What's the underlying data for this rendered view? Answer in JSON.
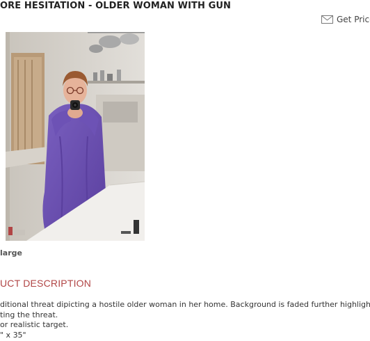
{
  "product": {
    "title": "ORE HESITATION - OLDER WOMAN WITH GUN",
    "image_alt": "Older woman in purple robe aiming a revolver in a kitchen",
    "enlarge_label": "large"
  },
  "header": {
    "get_price_label": "Get Price",
    "get_price_icon": "envelope-icon"
  },
  "description": {
    "heading": "UCT DESCRIPTION",
    "lines": [
      "ditional threat dipicting a hostile older woman in her home. Background is faded further highlighting",
      "ting the threat.",
      "or realistic target.",
      "\" x 35\""
    ]
  },
  "colors": {
    "heading_accent": "#b14545",
    "robe": "#6a4fb0",
    "title_text": "#222222"
  }
}
